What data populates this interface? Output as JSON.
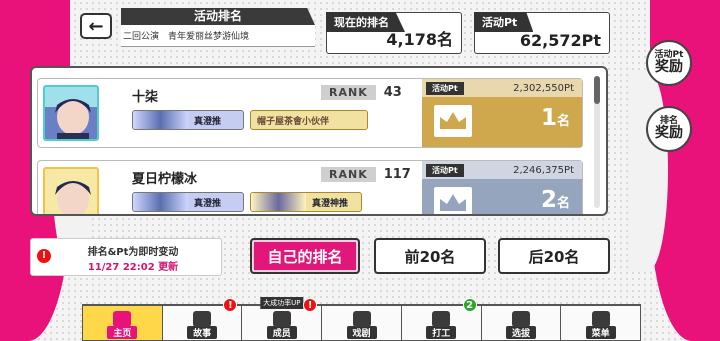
{
  "header": {
    "back_icon": "arrow-left-icon",
    "title": "活动排名",
    "subtitle": "二回公演　青年爱丽丝梦游仙境"
  },
  "stats": {
    "current_rank_label": "现在的排名",
    "current_rank_value": "4,178名",
    "event_pt_label": "活动Pt",
    "event_pt_value": "62,572Pt"
  },
  "rewards": {
    "pt_reward_small": "活动Pt",
    "pt_reward_big": "奖励",
    "rank_reward_small": "排名",
    "rank_reward_big": "奖励"
  },
  "ranking": {
    "rank_badge": "RANK",
    "pt_tag": "活动Pt",
    "rows": [
      {
        "name": "十柒",
        "rank": "43",
        "points": "2,302,550Pt",
        "place_num": "1",
        "place_unit": "名",
        "card1_label": "真澄推",
        "card2_label": "帽子屋茶會小伙伴"
      },
      {
        "name": "夏日柠檬冰",
        "rank": "117",
        "points": "2,246,375Pt",
        "place_num": "2",
        "place_unit": "名",
        "card1_label": "真澄推",
        "card2_label": "真澄神推"
      }
    ]
  },
  "notice": {
    "icon": "alert-icon",
    "line1": "排名&Pt为即时变动",
    "line2": "11/27 22:02 更新"
  },
  "buttons": {
    "my_rank": "自己的排名",
    "top20": "前20名",
    "next20": "后20名"
  },
  "bottom_nav": {
    "home": "主页",
    "story": "故事",
    "members": "成员",
    "members_promo": "大成功率UP",
    "play": "戏剧",
    "work": "打工",
    "work_badge": "2",
    "scout": "选拔",
    "menu": "菜单"
  },
  "colors": {
    "accent": "#e8127a",
    "gold": "#cfa84d",
    "silver": "#95a5bd"
  }
}
